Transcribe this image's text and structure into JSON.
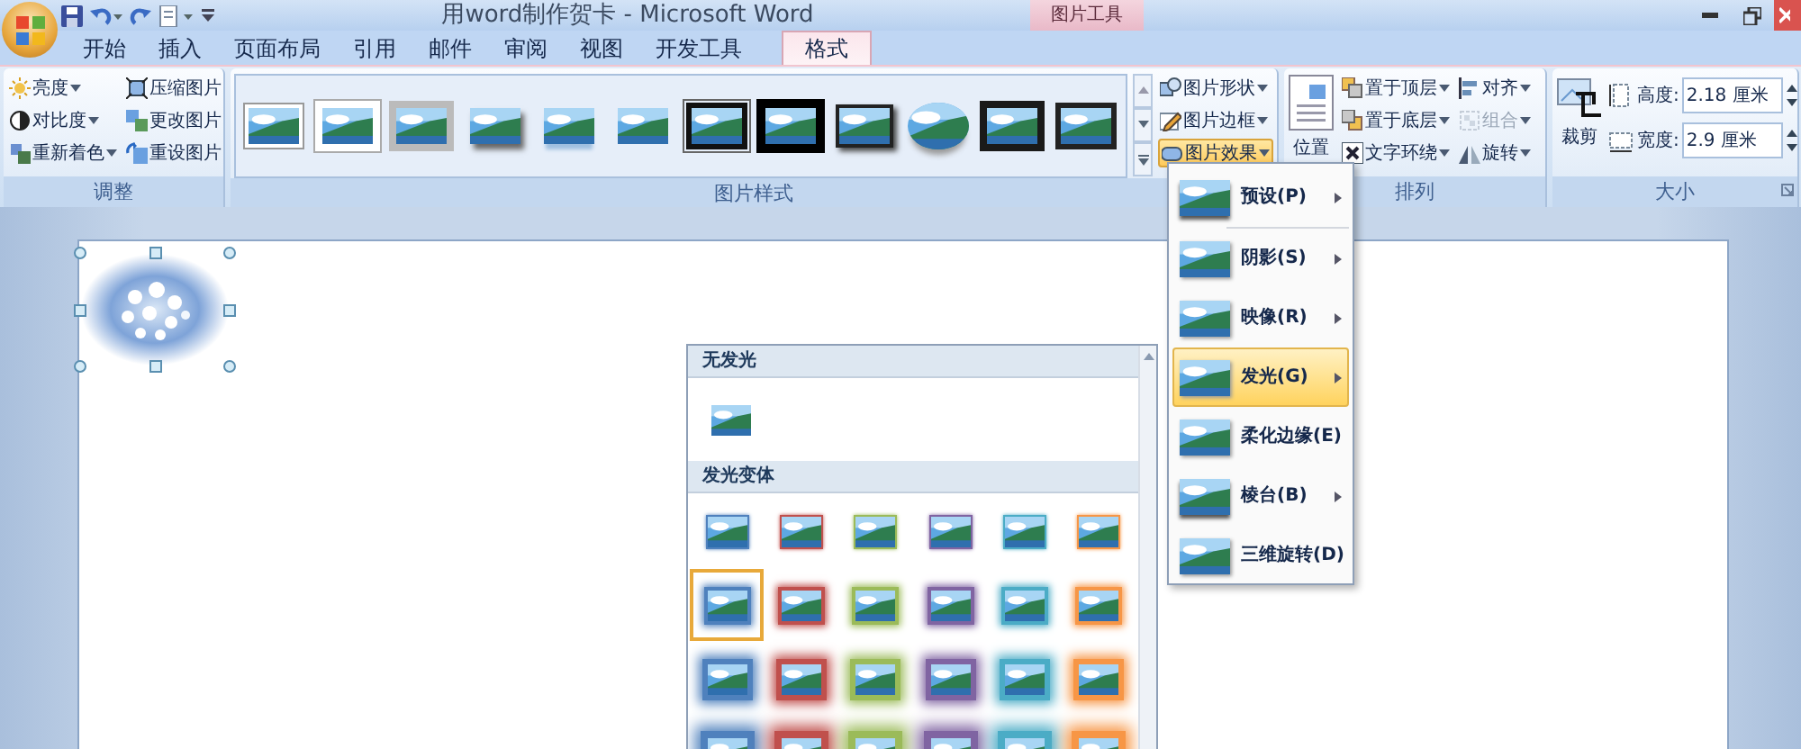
{
  "window": {
    "title": "用word制作贺卡 - Microsoft Word",
    "context_label": "图片工具"
  },
  "tabs": [
    {
      "label": "开始",
      "selected": false
    },
    {
      "label": "插入",
      "selected": false
    },
    {
      "label": "页面布局",
      "selected": false
    },
    {
      "label": "引用",
      "selected": false
    },
    {
      "label": "邮件",
      "selected": false
    },
    {
      "label": "审阅",
      "selected": false
    },
    {
      "label": "视图",
      "selected": false
    },
    {
      "label": "开发工具",
      "selected": false
    },
    {
      "label": "格式",
      "selected": true
    }
  ],
  "ribbon": {
    "adjust": {
      "label": "调整",
      "buttons": [
        {
          "label": "亮度",
          "dropdown": true
        },
        {
          "label": "对比度",
          "dropdown": true
        },
        {
          "label": "重新着色",
          "dropdown": true
        },
        {
          "label": "压缩图片",
          "dropdown": false
        },
        {
          "label": "更改图片",
          "dropdown": false
        },
        {
          "label": "重设图片",
          "dropdown": false
        }
      ]
    },
    "styles": {
      "label": "图片样式",
      "gallery": [
        {
          "kind": "white-frame"
        },
        {
          "kind": "white-thick"
        },
        {
          "kind": "gray-bevel"
        },
        {
          "kind": "shadow"
        },
        {
          "kind": "reflection"
        },
        {
          "kind": "soft-edge"
        },
        {
          "kind": "black-double"
        },
        {
          "kind": "black-thick"
        },
        {
          "kind": "black-shadow"
        },
        {
          "kind": "oval"
        },
        {
          "kind": "black-matte"
        },
        {
          "kind": "black-thin"
        }
      ],
      "buttons": [
        {
          "label": "图片形状",
          "open": false
        },
        {
          "label": "图片边框",
          "open": false
        },
        {
          "label": "图片效果",
          "open": true
        }
      ]
    },
    "arrange": {
      "label": "排列",
      "position_button": "位置",
      "buttons": [
        {
          "label": "置于顶层",
          "disabled": false
        },
        {
          "label": "置于底层",
          "disabled": false
        },
        {
          "label": "文字环绕",
          "disabled": false
        },
        {
          "label": "对齐",
          "disabled": false
        },
        {
          "label": "组合",
          "disabled": true
        },
        {
          "label": "旋转",
          "disabled": false
        }
      ]
    },
    "size": {
      "label": "大小",
      "crop_button": "裁剪",
      "fields": [
        {
          "label": "高度:",
          "value": "2.18 厘米"
        },
        {
          "label": "宽度:",
          "value": "2.9 厘米"
        }
      ]
    }
  },
  "effects_menu": [
    {
      "label": "预设(P)",
      "selected": false
    },
    {
      "label": "阴影(S)",
      "selected": false
    },
    {
      "label": "映像(R)",
      "selected": false
    },
    {
      "label": "发光(G)",
      "selected": true
    },
    {
      "label": "柔化边缘(E)",
      "selected": false
    },
    {
      "label": "棱台(B)",
      "selected": false
    },
    {
      "label": "三维旋转(D)",
      "selected": false
    }
  ],
  "glow_gallery": {
    "no_glow": {
      "title": "无发光",
      "items": [
        {
          "selected": false
        }
      ]
    },
    "variants": {
      "title": "发光变体",
      "rows": [
        {
          "items": [
            {
              "color": "#4f81bd",
              "selected": false
            },
            {
              "color": "#c0504d",
              "selected": false
            },
            {
              "color": "#9bbb59",
              "selected": false
            },
            {
              "color": "#8064a2",
              "selected": false
            },
            {
              "color": "#4bacc6",
              "selected": false
            },
            {
              "color": "#f79646",
              "selected": false
            }
          ]
        },
        {
          "items": [
            {
              "color": "#4f81bd",
              "selected": true
            },
            {
              "color": "#c0504d",
              "selected": false
            },
            {
              "color": "#9bbb59",
              "selected": false
            },
            {
              "color": "#8064a2",
              "selected": false
            },
            {
              "color": "#4bacc6",
              "selected": false
            },
            {
              "color": "#f79646",
              "selected": false
            }
          ]
        },
        {
          "items": [
            {
              "color": "#4f81bd",
              "selected": false
            },
            {
              "color": "#c0504d",
              "selected": false
            },
            {
              "color": "#9bbb59",
              "selected": false
            },
            {
              "color": "#8064a2",
              "selected": false
            },
            {
              "color": "#4bacc6",
              "selected": false
            },
            {
              "color": "#f79646",
              "selected": false
            }
          ]
        },
        {
          "items": [
            {
              "color": "#4f81bd",
              "selected": false
            },
            {
              "color": "#c0504d",
              "selected": false
            },
            {
              "color": "#9bbb59",
              "selected": false
            },
            {
              "color": "#8064a2",
              "selected": false
            },
            {
              "color": "#4bacc6",
              "selected": false
            },
            {
              "color": "#f79646",
              "selected": false
            }
          ]
        }
      ]
    }
  }
}
